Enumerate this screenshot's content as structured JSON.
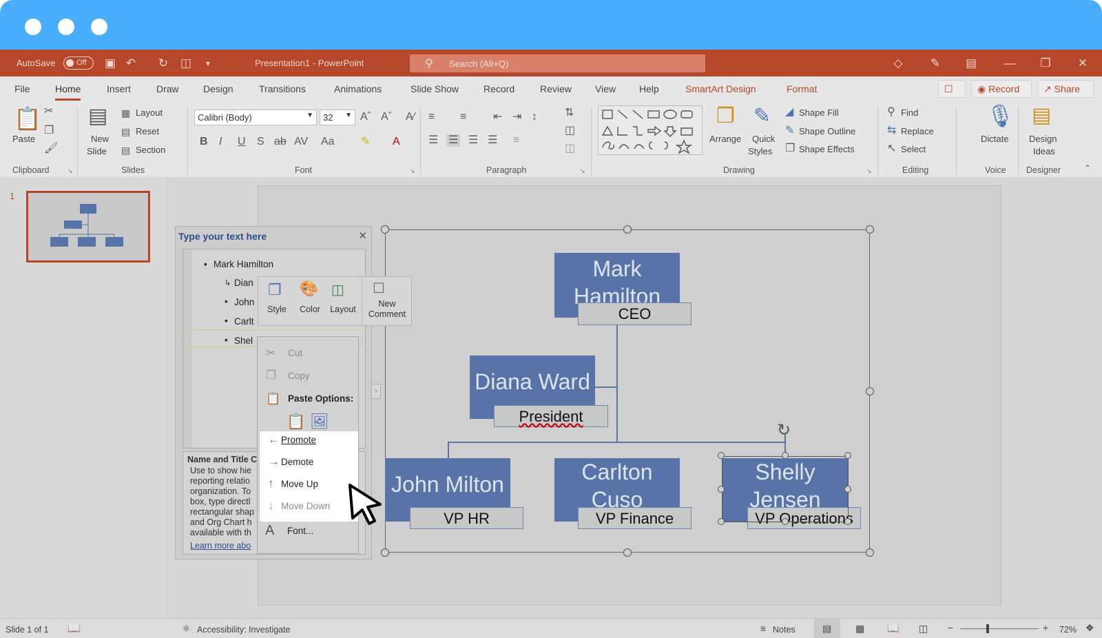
{
  "titlebar": {
    "autosave_label": "AutoSave",
    "autosave_state": "Off",
    "doc_title": "Presentation1  -  PowerPoint",
    "search_placeholder": "Search (Alt+Q)"
  },
  "tabs": [
    {
      "label": "File"
    },
    {
      "label": "Home"
    },
    {
      "label": "Insert"
    },
    {
      "label": "Draw"
    },
    {
      "label": "Design"
    },
    {
      "label": "Transitions"
    },
    {
      "label": "Animations"
    },
    {
      "label": "Slide Show"
    },
    {
      "label": "Record"
    },
    {
      "label": "Review"
    },
    {
      "label": "View"
    },
    {
      "label": "Help"
    },
    {
      "label": "SmartArt Design"
    },
    {
      "label": "Format"
    }
  ],
  "tab_buttons": {
    "record": "Record",
    "share": "Share"
  },
  "ribbon": {
    "clipboard": {
      "paste": "Paste",
      "group": "Clipboard"
    },
    "slides": {
      "new_slide_1": "New",
      "new_slide_2": "Slide",
      "layout": "Layout",
      "reset": "Reset",
      "section": "Section",
      "group": "Slides"
    },
    "font": {
      "font_name": "Calibri (Body)",
      "font_size": "32",
      "group": "Font"
    },
    "paragraph": {
      "group": "Paragraph"
    },
    "drawing": {
      "arrange": "Arrange",
      "quick_styles_1": "Quick",
      "quick_styles_2": "Styles",
      "shape_fill": "Shape Fill",
      "shape_outline": "Shape Outline",
      "shape_effects": "Shape Effects",
      "group": "Drawing"
    },
    "editing": {
      "find": "Find",
      "replace": "Replace",
      "select": "Select",
      "group": "Editing"
    },
    "voice": {
      "dictate": "Dictate",
      "group": "Voice"
    },
    "designer": {
      "design_ideas_1": "Design",
      "design_ideas_2": "Ideas",
      "group": "Designer"
    }
  },
  "thumbnail": {
    "slide_number": "1"
  },
  "text_pane": {
    "title": "Type your text here",
    "items": [
      "Mark Hamilton",
      "Dian",
      "John",
      "Carlt",
      "Shel"
    ],
    "desc_title": "Name and Title C",
    "desc_lines": [
      "Use to show hie",
      "reporting relatio",
      "organization. To",
      "box, type directl",
      "rectangular shap",
      "and Org Chart h",
      "available with th"
    ],
    "learn_more": "Learn more abo"
  },
  "mini_toolbar": {
    "style": "Style",
    "color": "Color",
    "layout": "Layout",
    "new_comment_1": "New",
    "new_comment_2": "Comment"
  },
  "context_menu": {
    "cut": "Cut",
    "copy": "Copy",
    "paste_options": "Paste Options:",
    "promote": "Promote",
    "demote": "Demote",
    "move_up": "Move Up",
    "move_down": "Move Down",
    "font": "Font..."
  },
  "org_chart": {
    "ceo": {
      "name_1": "Mark",
      "name_2": "Hamilton",
      "title": "CEO"
    },
    "president": {
      "name": "Diana Ward",
      "title": "President"
    },
    "vp_hr": {
      "name": "John Milton",
      "title": "VP HR"
    },
    "vp_finance": {
      "name_1": "Carlton",
      "name_2": "Cuso",
      "title": "VP Finance"
    },
    "vp_ops": {
      "name_1": "Shelly",
      "name_2": "Jensen",
      "title": "VP Operations"
    }
  },
  "status": {
    "slide_info": "Slide 1 of 1",
    "accessibility": "Accessibility: Investigate",
    "notes": "Notes",
    "zoom": "72%"
  },
  "colors": {
    "accent": "#b7472a",
    "chrome": "#4aaeff",
    "node": "#5773a8"
  }
}
